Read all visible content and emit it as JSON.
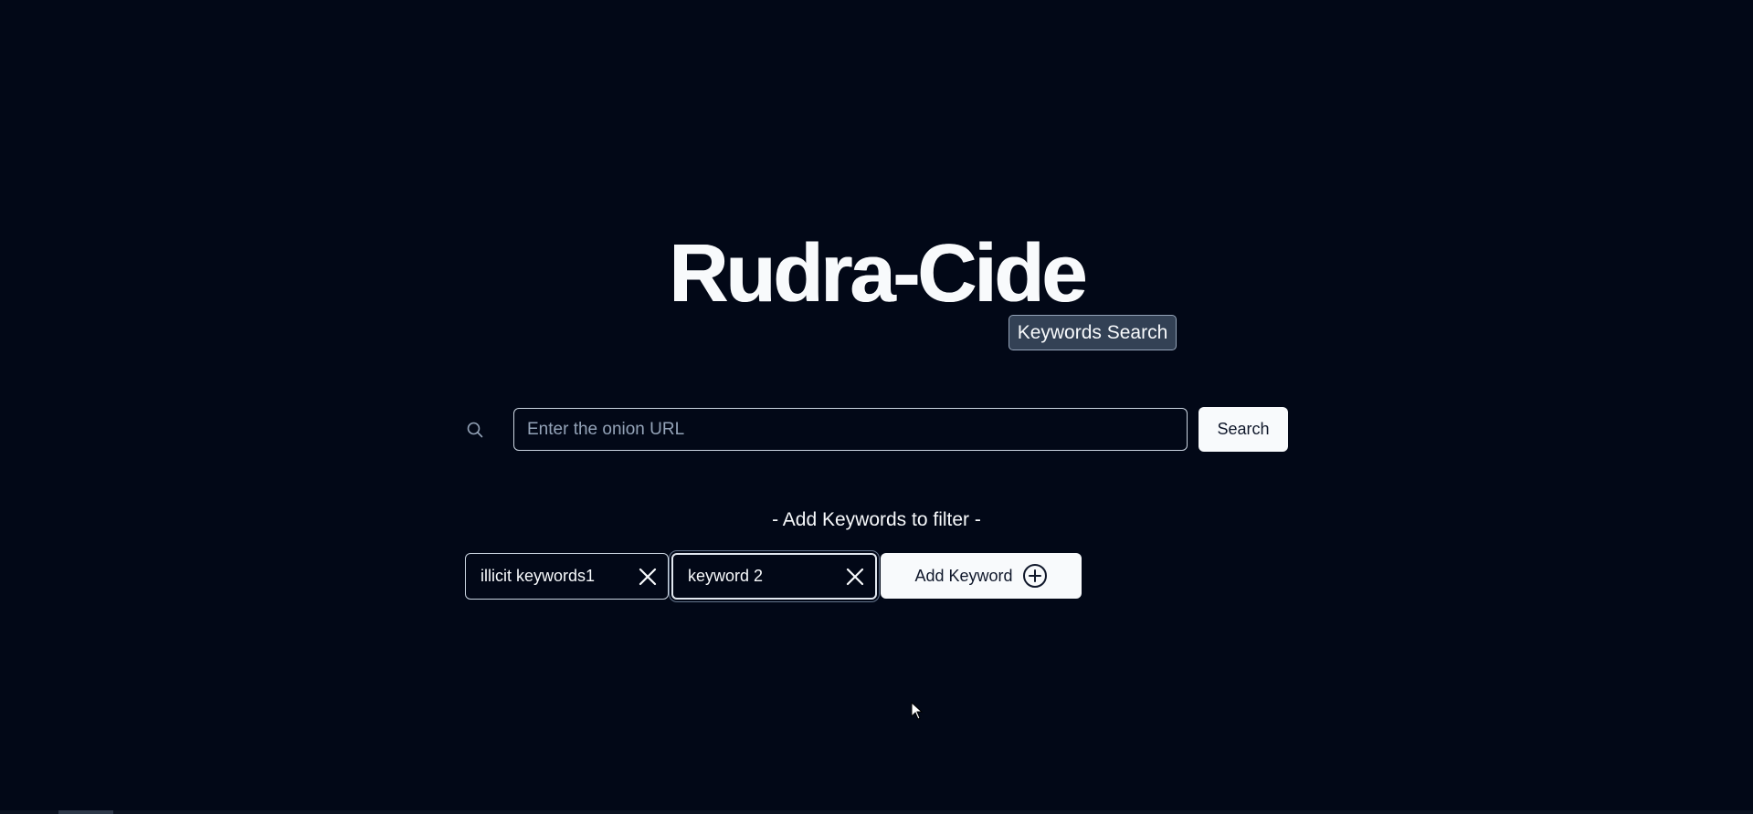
{
  "app": {
    "title": "Rudra-Cide",
    "mode_tooltip": "Keywords Search"
  },
  "search": {
    "icon": "search-icon",
    "placeholder": "Enter the onion URL",
    "value": "",
    "button_label": "Search"
  },
  "filter": {
    "heading": "- Add Keywords to filter -",
    "keywords": [
      {
        "value": "illicit keywords1",
        "remove_icon": "close-icon"
      },
      {
        "value": "keyword 2",
        "remove_icon": "close-icon"
      }
    ],
    "add_button_label": "Add Keyword",
    "add_icon": "plus-circle-icon"
  },
  "colors": {
    "background": "#020817",
    "foreground": "#f8fafc",
    "button_background": "#f8fafc",
    "button_text": "#0f172a",
    "border": "#cbd5e1",
    "tooltip_background": "#334155"
  }
}
